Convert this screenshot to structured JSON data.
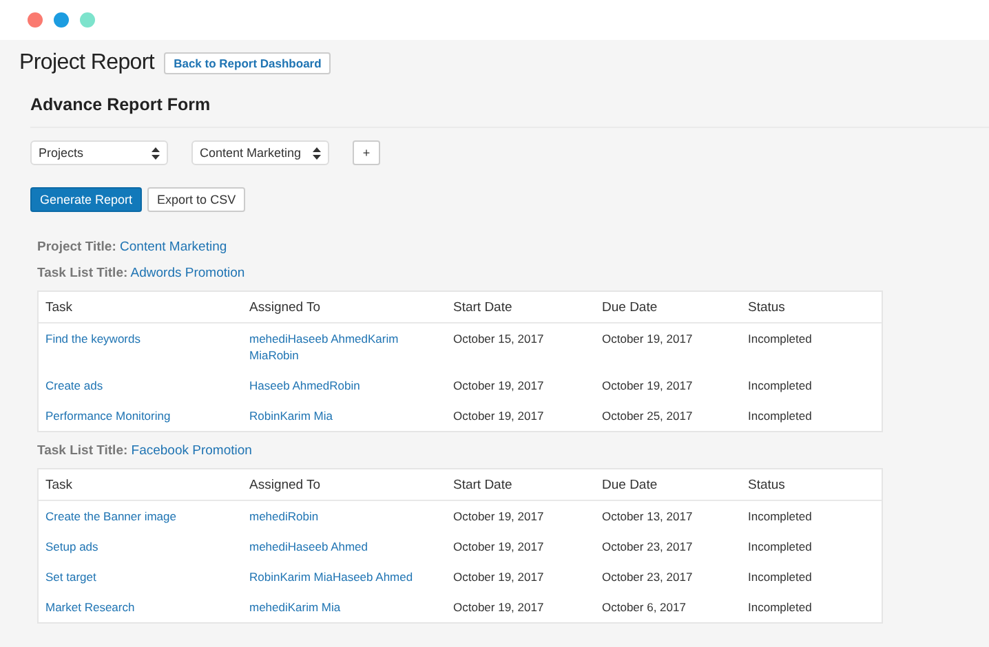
{
  "page": {
    "title": "Project Report",
    "back_button": "Back to Report Dashboard"
  },
  "form": {
    "title": "Advance Report Form",
    "selects": [
      {
        "value": "Projects"
      },
      {
        "value": "Content Marketing"
      }
    ],
    "add_button": "+",
    "buttons": [
      {
        "label": "Generate Report",
        "kind": "primary"
      },
      {
        "label": "Export to CSV",
        "kind": "secondary"
      }
    ]
  },
  "report": {
    "project_label": "Project Title:",
    "project_title": "Content Marketing",
    "task_lists": [
      {
        "label": "Task List Title:",
        "title": "Adwords Promotion",
        "columns": [
          "Task",
          "Assigned To",
          "Start Date",
          "Due Date",
          "Status"
        ],
        "rows": [
          {
            "task": "Find the keywords",
            "assigned": "mehediHaseeb AhmedKarim MiaRobin",
            "start": "October 15, 2017",
            "due": "October 19, 2017",
            "status": "Incompleted"
          },
          {
            "task": "Create ads",
            "assigned": "Haseeb AhmedRobin",
            "start": "October 19, 2017",
            "due": "October 19, 2017",
            "status": "Incompleted"
          },
          {
            "task": "Performance Monitoring",
            "assigned": "RobinKarim Mia",
            "start": "October 19, 2017",
            "due": "October 25, 2017",
            "status": "Incompleted"
          }
        ]
      },
      {
        "label": "Task List Title:",
        "title": "Facebook Promotion",
        "columns": [
          "Task",
          "Assigned To",
          "Start Date",
          "Due Date",
          "Status"
        ],
        "rows": [
          {
            "task": "Create the Banner image",
            "assigned": "mehediRobin",
            "start": "October 19, 2017",
            "due": "October 13, 2017",
            "status": "Incompleted"
          },
          {
            "task": "Setup ads",
            "assigned": "mehediHaseeb Ahmed",
            "start": "October 19, 2017",
            "due": "October 23, 2017",
            "status": "Incompleted"
          },
          {
            "task": "Set target",
            "assigned": "RobinKarim MiaHaseeb Ahmed",
            "start": "October 19, 2017",
            "due": "October 23, 2017",
            "status": "Incompleted"
          },
          {
            "task": "Market Research",
            "assigned": "mehediKarim Mia",
            "start": "October 19, 2017",
            "due": "October 6, 2017",
            "status": "Incompleted"
          }
        ]
      }
    ]
  }
}
